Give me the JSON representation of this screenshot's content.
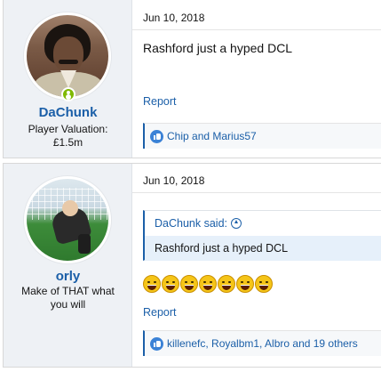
{
  "posts": [
    {
      "user": {
        "name": "DaChunk",
        "title_line1": "Player Valuation:",
        "title_line2": "£1.5m",
        "online": true
      },
      "date": "Jun 10, 2018",
      "body": "Rashford just a hyped DCL",
      "report_label": "Report",
      "reactions": "Chip and Marius57"
    },
    {
      "user": {
        "name": "orly",
        "title_line1": "Make of THAT what",
        "title_line2": "you will"
      },
      "date": "Jun 10, 2018",
      "quote": {
        "author_label": "DaChunk said:",
        "text": "Rashford just a hyped DCL"
      },
      "emoji_count": 7,
      "emoji_name": "laughing-emoji",
      "report_label": "Report",
      "reactions": "killenefc, Royalbm1, Albro and 19 others"
    }
  ],
  "colors": {
    "link": "#1b5fa8",
    "online": "#7fb900",
    "quote_bg": "#e6f0fa",
    "user_col_bg": "#eef1f5"
  }
}
